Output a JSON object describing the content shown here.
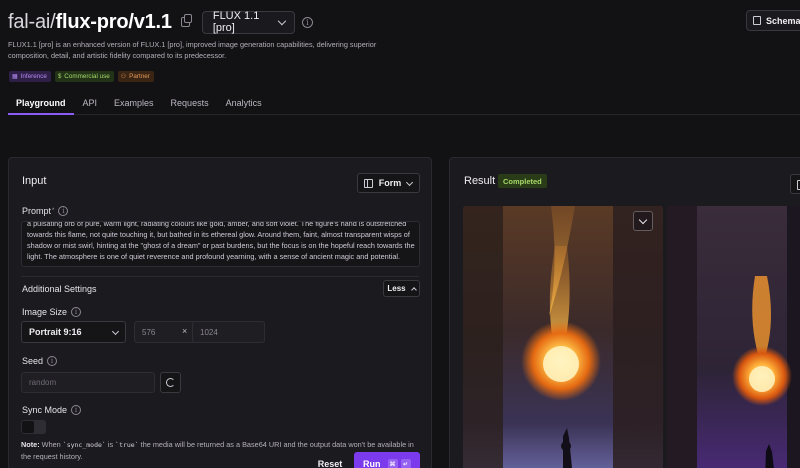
{
  "header": {
    "org": "fal-ai/",
    "model": "flux-pro/v1.1",
    "version_selected": "FLUX 1.1 [pro]",
    "schema_label": "Schema",
    "description": "FLUX1.1 [pro] is an enhanced version of FLUX.1 [pro], improved image generation capabilities, delivering superior composition, detail, and artistic fidelity compared to its predecessor.",
    "badges": [
      {
        "label": "Inference",
        "icon": "grid-icon"
      },
      {
        "label": "Commercial use",
        "icon": "dollar-icon"
      },
      {
        "label": "Partner",
        "icon": "people-icon"
      }
    ]
  },
  "tabs": [
    "Playground",
    "API",
    "Examples",
    "Requests",
    "Analytics"
  ],
  "active_tab": "Playground",
  "input": {
    "title": "Input",
    "mode_selected": "Form",
    "prompt_label": "Prompt",
    "prompt_required_mark": "*",
    "prompt_text": "a pulsating orb of pure, warm light, radiating colours like gold, amber, and soft violet. The figure's hand is outstretched towards this flame, not quite touching it, but bathed in its ethereal glow. Around them, faint, almost transparent wisps of shadow or mist swirl, hinting at the \"ghost of a dream\" or past burdens, but the focus is on the hopeful reach towards the light. The atmosphere is one of quiet reverence and profound yearning, with a sense of ancient magic and potential.",
    "additional_settings_label": "Additional Settings",
    "toggle_settings_label": "Less",
    "image_size_label": "Image Size",
    "image_size_selected": "Portrait 9:16",
    "width_value": "576",
    "times_symbol": "×",
    "height_value": "1024",
    "seed_label": "Seed",
    "seed_placeholder": "random",
    "sync_mode_label": "Sync Mode",
    "sync_mode_on": false,
    "note_label": "Note:",
    "note_text_1": " When ",
    "note_code_1": "`sync_mode`",
    "note_text_2": " is ",
    "note_code_2": "`true`",
    "note_text_3": " the media will be returned as a Base64 URI and the output data won't be available in the request history.",
    "reset_label": "Reset",
    "run_label": "Run",
    "run_shortcut_1": "⌘",
    "run_shortcut_2": "↵"
  },
  "result": {
    "title": "Result",
    "status": "Completed"
  },
  "colors": {
    "accent": "#7c3aed",
    "tab_underline": "#8b5cf6",
    "status_green": "#a6d96a"
  }
}
